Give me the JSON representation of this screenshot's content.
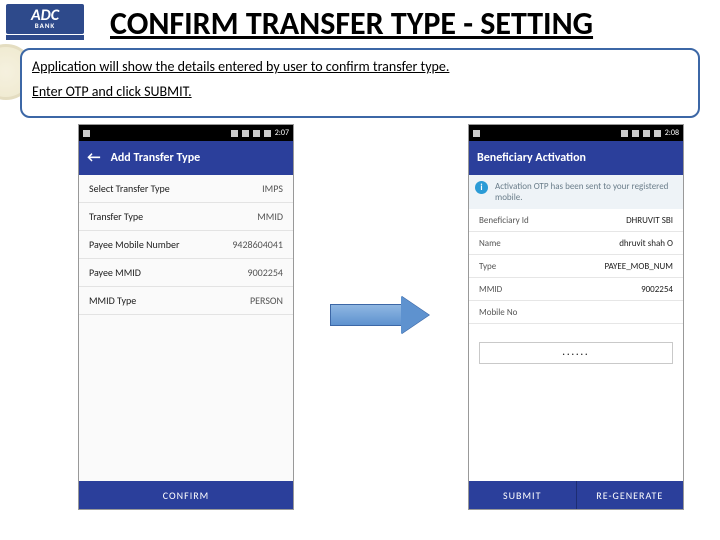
{
  "logo": {
    "main": "ADC",
    "sub": "BANK"
  },
  "title": "CONFIRM TRANSFER TYPE - SETTING",
  "description": {
    "line1": "Application will show the details entered by user to confirm transfer type.",
    "line2": "Enter OTP and click SUBMIT."
  },
  "phone_left": {
    "time": "2:07",
    "appbar_title": "Add Transfer Type",
    "rows": [
      {
        "label": "Select Transfer Type",
        "value": "IMPS"
      },
      {
        "label": "Transfer Type",
        "value": "MMID"
      },
      {
        "label": "Payee Mobile Number",
        "value": "9428604041"
      },
      {
        "label": "Payee MMID",
        "value": "9002254"
      },
      {
        "label": "MMID Type",
        "value": "PERSON"
      }
    ],
    "buttons": {
      "confirm": "CONFIRM"
    }
  },
  "phone_right": {
    "time": "2:08",
    "appbar_title": "Beneficiary Activation",
    "info_text": "Activation OTP has been sent to your registered mobile.",
    "rows": [
      {
        "label": "Beneficiary Id",
        "value": "DHRUVIT SBI"
      },
      {
        "label": "Name",
        "value": "dhruvit shah   O"
      },
      {
        "label": "Type",
        "value": "PAYEE_MOB_NUM"
      },
      {
        "label": "MMID",
        "value": "9002254"
      },
      {
        "label": "Mobile No",
        "value": ""
      }
    ],
    "otp_value": "······",
    "buttons": {
      "submit": "SUBMIT",
      "regenerate": "RE-GENERATE"
    }
  }
}
